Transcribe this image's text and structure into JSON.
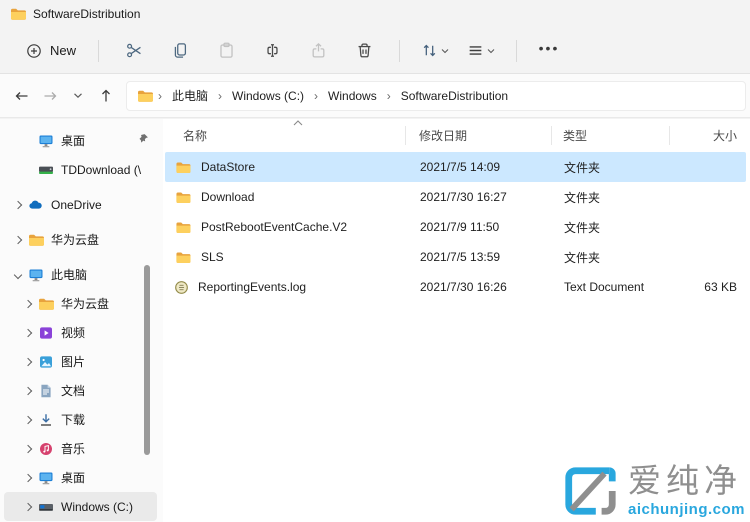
{
  "window": {
    "tab_title": "SoftwareDistribution"
  },
  "toolbar": {
    "new_label": "New"
  },
  "navbar": {
    "breadcrumbs": [
      "此电脑",
      "Windows (C:)",
      "Windows",
      "SoftwareDistribution"
    ]
  },
  "sidebar": {
    "items": [
      {
        "label": "桌面",
        "pinned": true
      },
      {
        "label": "TDDownload (\\",
        "pinned": true
      },
      {
        "label": "OneDrive"
      },
      {
        "label": "华为云盘"
      },
      {
        "label": "此电脑",
        "expanded": true
      },
      {
        "label": "华为云盘"
      },
      {
        "label": "视频"
      },
      {
        "label": "图片"
      },
      {
        "label": "文档"
      },
      {
        "label": "下载"
      },
      {
        "label": "音乐"
      },
      {
        "label": "桌面"
      },
      {
        "label": "Windows (C:)",
        "selected": true
      }
    ]
  },
  "files": {
    "columns": {
      "name": "名称",
      "date": "修改日期",
      "type": "类型",
      "size": "大小"
    },
    "rows": [
      {
        "name": "DataStore",
        "date": "2021/7/5 14:09",
        "type": "文件夹",
        "size": "",
        "selected": true
      },
      {
        "name": "Download",
        "date": "2021/7/30 16:27",
        "type": "文件夹",
        "size": ""
      },
      {
        "name": "PostRebootEventCache.V2",
        "date": "2021/7/9 11:50",
        "type": "文件夹",
        "size": ""
      },
      {
        "name": "SLS",
        "date": "2021/7/5 13:59",
        "type": "文件夹",
        "size": ""
      },
      {
        "name": "ReportingEvents.log",
        "date": "2021/7/30 16:26",
        "type": "Text Document",
        "size": "63 KB"
      }
    ]
  },
  "watermark": {
    "brand": "爱纯净",
    "domain": "aichunjing.com"
  },
  "colors": {
    "accent": "#29a7de",
    "selection": "#cce8ff",
    "folder": "#fdd05e",
    "sidebar_selection": "#eaeaea"
  }
}
